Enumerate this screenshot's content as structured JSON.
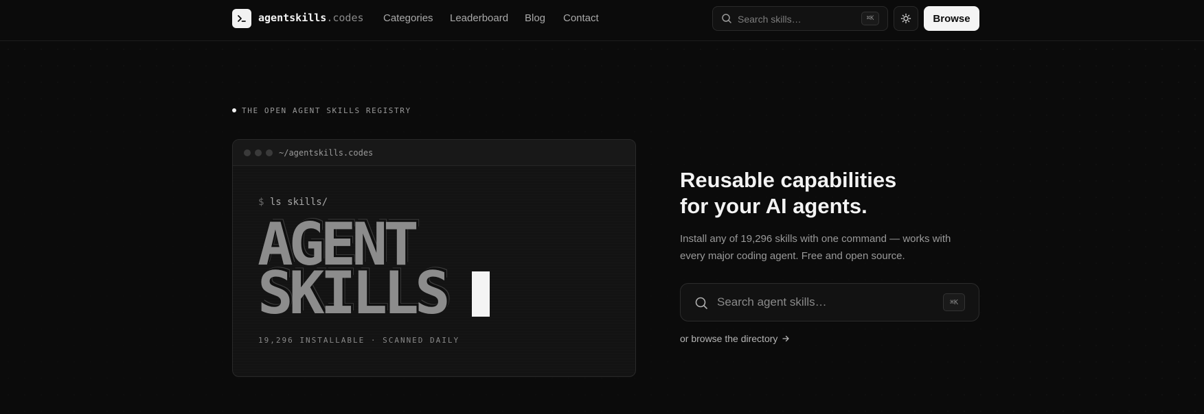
{
  "nav": {
    "logo_icon": "terminal-prompt-icon",
    "brand_name": "agentskills",
    "brand_tld": ".codes",
    "links": [
      "Categories",
      "Leaderboard",
      "Blog",
      "Contact"
    ],
    "search_placeholder": "Search skills…",
    "search_shortcut": "⌘K",
    "theme_icon": "sun-icon",
    "browse_label": "Browse"
  },
  "hero": {
    "eyebrow": "THE OPEN AGENT SKILLS REGISTRY",
    "terminal": {
      "path": "~/agentskills.codes",
      "prompt_symbol": "$",
      "command": "ls skills/",
      "line1": "AGENT",
      "line2": "SKILLS",
      "footer": "19,296 INSTALLABLE · SCANNED DAILY"
    },
    "headline_line1": "Reusable capabilities",
    "headline_line2": "for your AI agents.",
    "subtext": "Install any of 19,296 skills with one command — works with every major coding agent. Free and open source.",
    "search_placeholder": "Search agent skills…",
    "search_shortcut": "⌘K",
    "browse_link": "or browse the directory",
    "browse_link_icon": "arrow-right-icon"
  },
  "colors": {
    "background": "#0b0b0b",
    "accent_button": "#f4f4f4",
    "muted_text": "#9a9a9a"
  }
}
